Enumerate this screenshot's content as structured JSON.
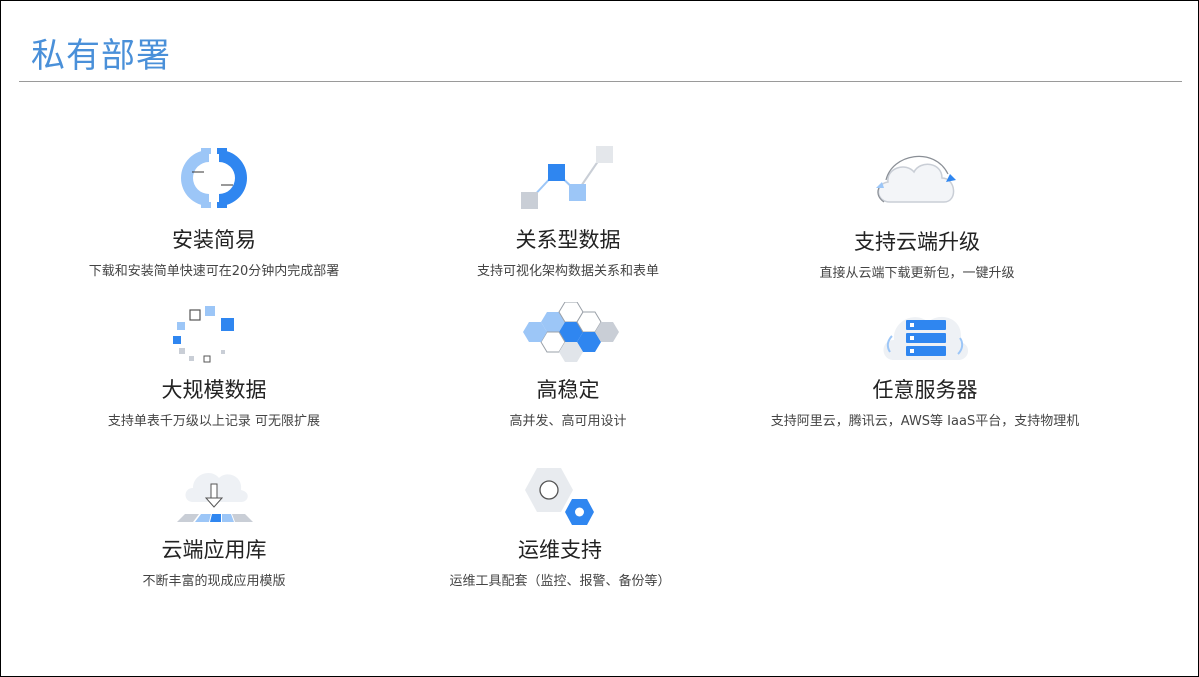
{
  "page": {
    "title": "私有部署"
  },
  "colors": {
    "accent": "#4a90d9",
    "blue": "#2f86f0",
    "light_blue": "#9cc6f7",
    "gray": "#c9ced6"
  },
  "features": [
    {
      "icon": "magnet-icon",
      "title": "安装简易",
      "desc": "下载和安装简单快速可在20分钟内完成部署"
    },
    {
      "icon": "relation-chart-icon",
      "title": "关系型数据",
      "desc": "支持可视化架构数据关系和表单"
    },
    {
      "icon": "cloud-sync-icon",
      "title": "支持云端升级",
      "desc": "直接从云端下载更新包，一键升级"
    },
    {
      "icon": "scatter-squares-icon",
      "title": "大规模数据",
      "desc": "支持单表千万级以上记录 可无限扩展"
    },
    {
      "icon": "hexagon-cluster-icon",
      "title": "高稳定",
      "desc": "高并发、高可用设计"
    },
    {
      "icon": "server-cloud-icon",
      "title": "任意服务器",
      "desc": "支持阿里云，腾讯云，AWS等 IaaS平台，支持物理机"
    },
    {
      "icon": "cloud-download-icon",
      "title": "云端应用库",
      "desc": "不断丰富的现成应用模版"
    },
    {
      "icon": "hexagon-gear-icon",
      "title": "运维支持",
      "desc": "运维工具配套（监控、报警、备份等）"
    }
  ]
}
